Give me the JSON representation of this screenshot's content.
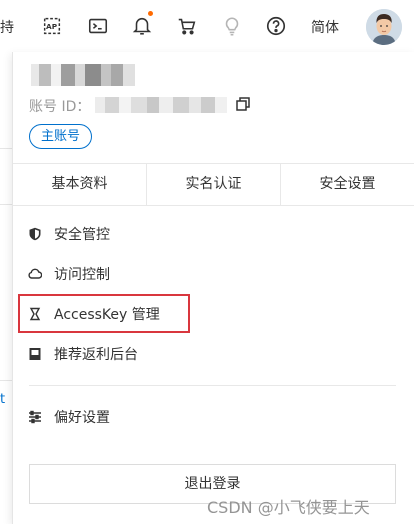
{
  "topbar": {
    "cut_text": "持",
    "lang_label": "简体",
    "icons": [
      "api-icon",
      "terminal-icon",
      "bell-icon",
      "cart-icon",
      "lightbulb-icon",
      "help-icon"
    ],
    "notification_dot_color": "#ff6a00"
  },
  "account": {
    "uid_label": "账号 ID：",
    "badge": "主账号"
  },
  "tabs": [
    {
      "label": "基本资料"
    },
    {
      "label": "实名认证"
    },
    {
      "label": "安全设置"
    }
  ],
  "menu": [
    {
      "label": "安全管控",
      "icon": "shield-icon"
    },
    {
      "label": "访问控制",
      "icon": "cloud-icon"
    },
    {
      "label": "AccessKey 管理",
      "icon": "key-icon"
    },
    {
      "label": "推荐返利后台",
      "icon": "rebate-icon"
    },
    {
      "label": "偏好设置",
      "icon": "sliders-icon"
    }
  ],
  "logout_label": "退出登录",
  "background": {
    "link_fragment": "t"
  },
  "watermark": "CSDN @小飞侠要上天",
  "colors": {
    "accent": "#0070cc",
    "highlight_border": "#d9363e"
  }
}
